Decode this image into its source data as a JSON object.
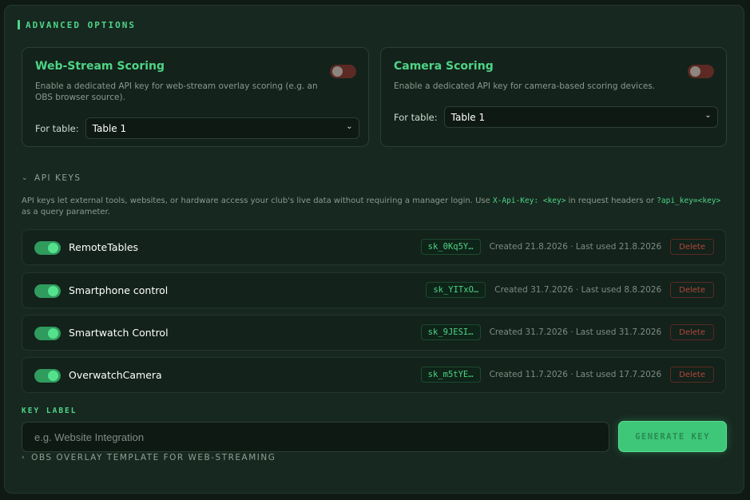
{
  "section": {
    "title": "ADVANCED OPTIONS"
  },
  "web_stream": {
    "title": "Web-Stream Scoring",
    "description": "Enable a dedicated API key for web-stream overlay scoring (e.g. an OBS browser source).",
    "enabled": false,
    "table_label": "For table:",
    "table_value": "Table 1"
  },
  "camera": {
    "title": "Camera Scoring",
    "description": "Enable a dedicated API key for camera-based scoring devices.",
    "enabled": false,
    "table_label": "For table:",
    "table_value": "Table 1"
  },
  "api_keys": {
    "header_arrow": "⌄",
    "header": "API KEYS",
    "help_1": "API keys let external tools, websites, or hardware access your club's live data without requiring a manager login. Use ",
    "help_code_1": "X-Api-Key: <key>",
    "help_2": " in request headers or ",
    "help_code_2": "?api_key=<key>",
    "help_3": " as a query parameter.",
    "items": [
      {
        "name": "RemoteTables",
        "key": "sk_0Kq5Y…",
        "meta": "Created 21.8.2026 · Last used 21.8.2026",
        "delete_label": "Delete",
        "enabled": true
      },
      {
        "name": "Smartphone control",
        "key": "sk_YITxO…",
        "meta": "Created 31.7.2026 · Last used 8.8.2026",
        "delete_label": "Delete",
        "enabled": true
      },
      {
        "name": "Smartwatch Control",
        "key": "sk_9JESI…",
        "meta": "Created 31.7.2026 · Last used 31.7.2026",
        "delete_label": "Delete",
        "enabled": true
      },
      {
        "name": "OverwatchCamera",
        "key": "sk_m5tYE…",
        "meta": "Created 11.7.2026 · Last used 17.7.2026",
        "delete_label": "Delete",
        "enabled": true
      }
    ]
  },
  "key_label": {
    "header": "KEY LABEL",
    "placeholder": "e.g. Website Integration",
    "button": "GENERATE KEY"
  },
  "obs": {
    "arrow": "›",
    "header": "OBS OVERLAY TEMPLATE FOR WEB-STREAMING"
  },
  "colors": {
    "accent": "#4ed487",
    "danger": "#b1473b",
    "background": "#172820"
  }
}
